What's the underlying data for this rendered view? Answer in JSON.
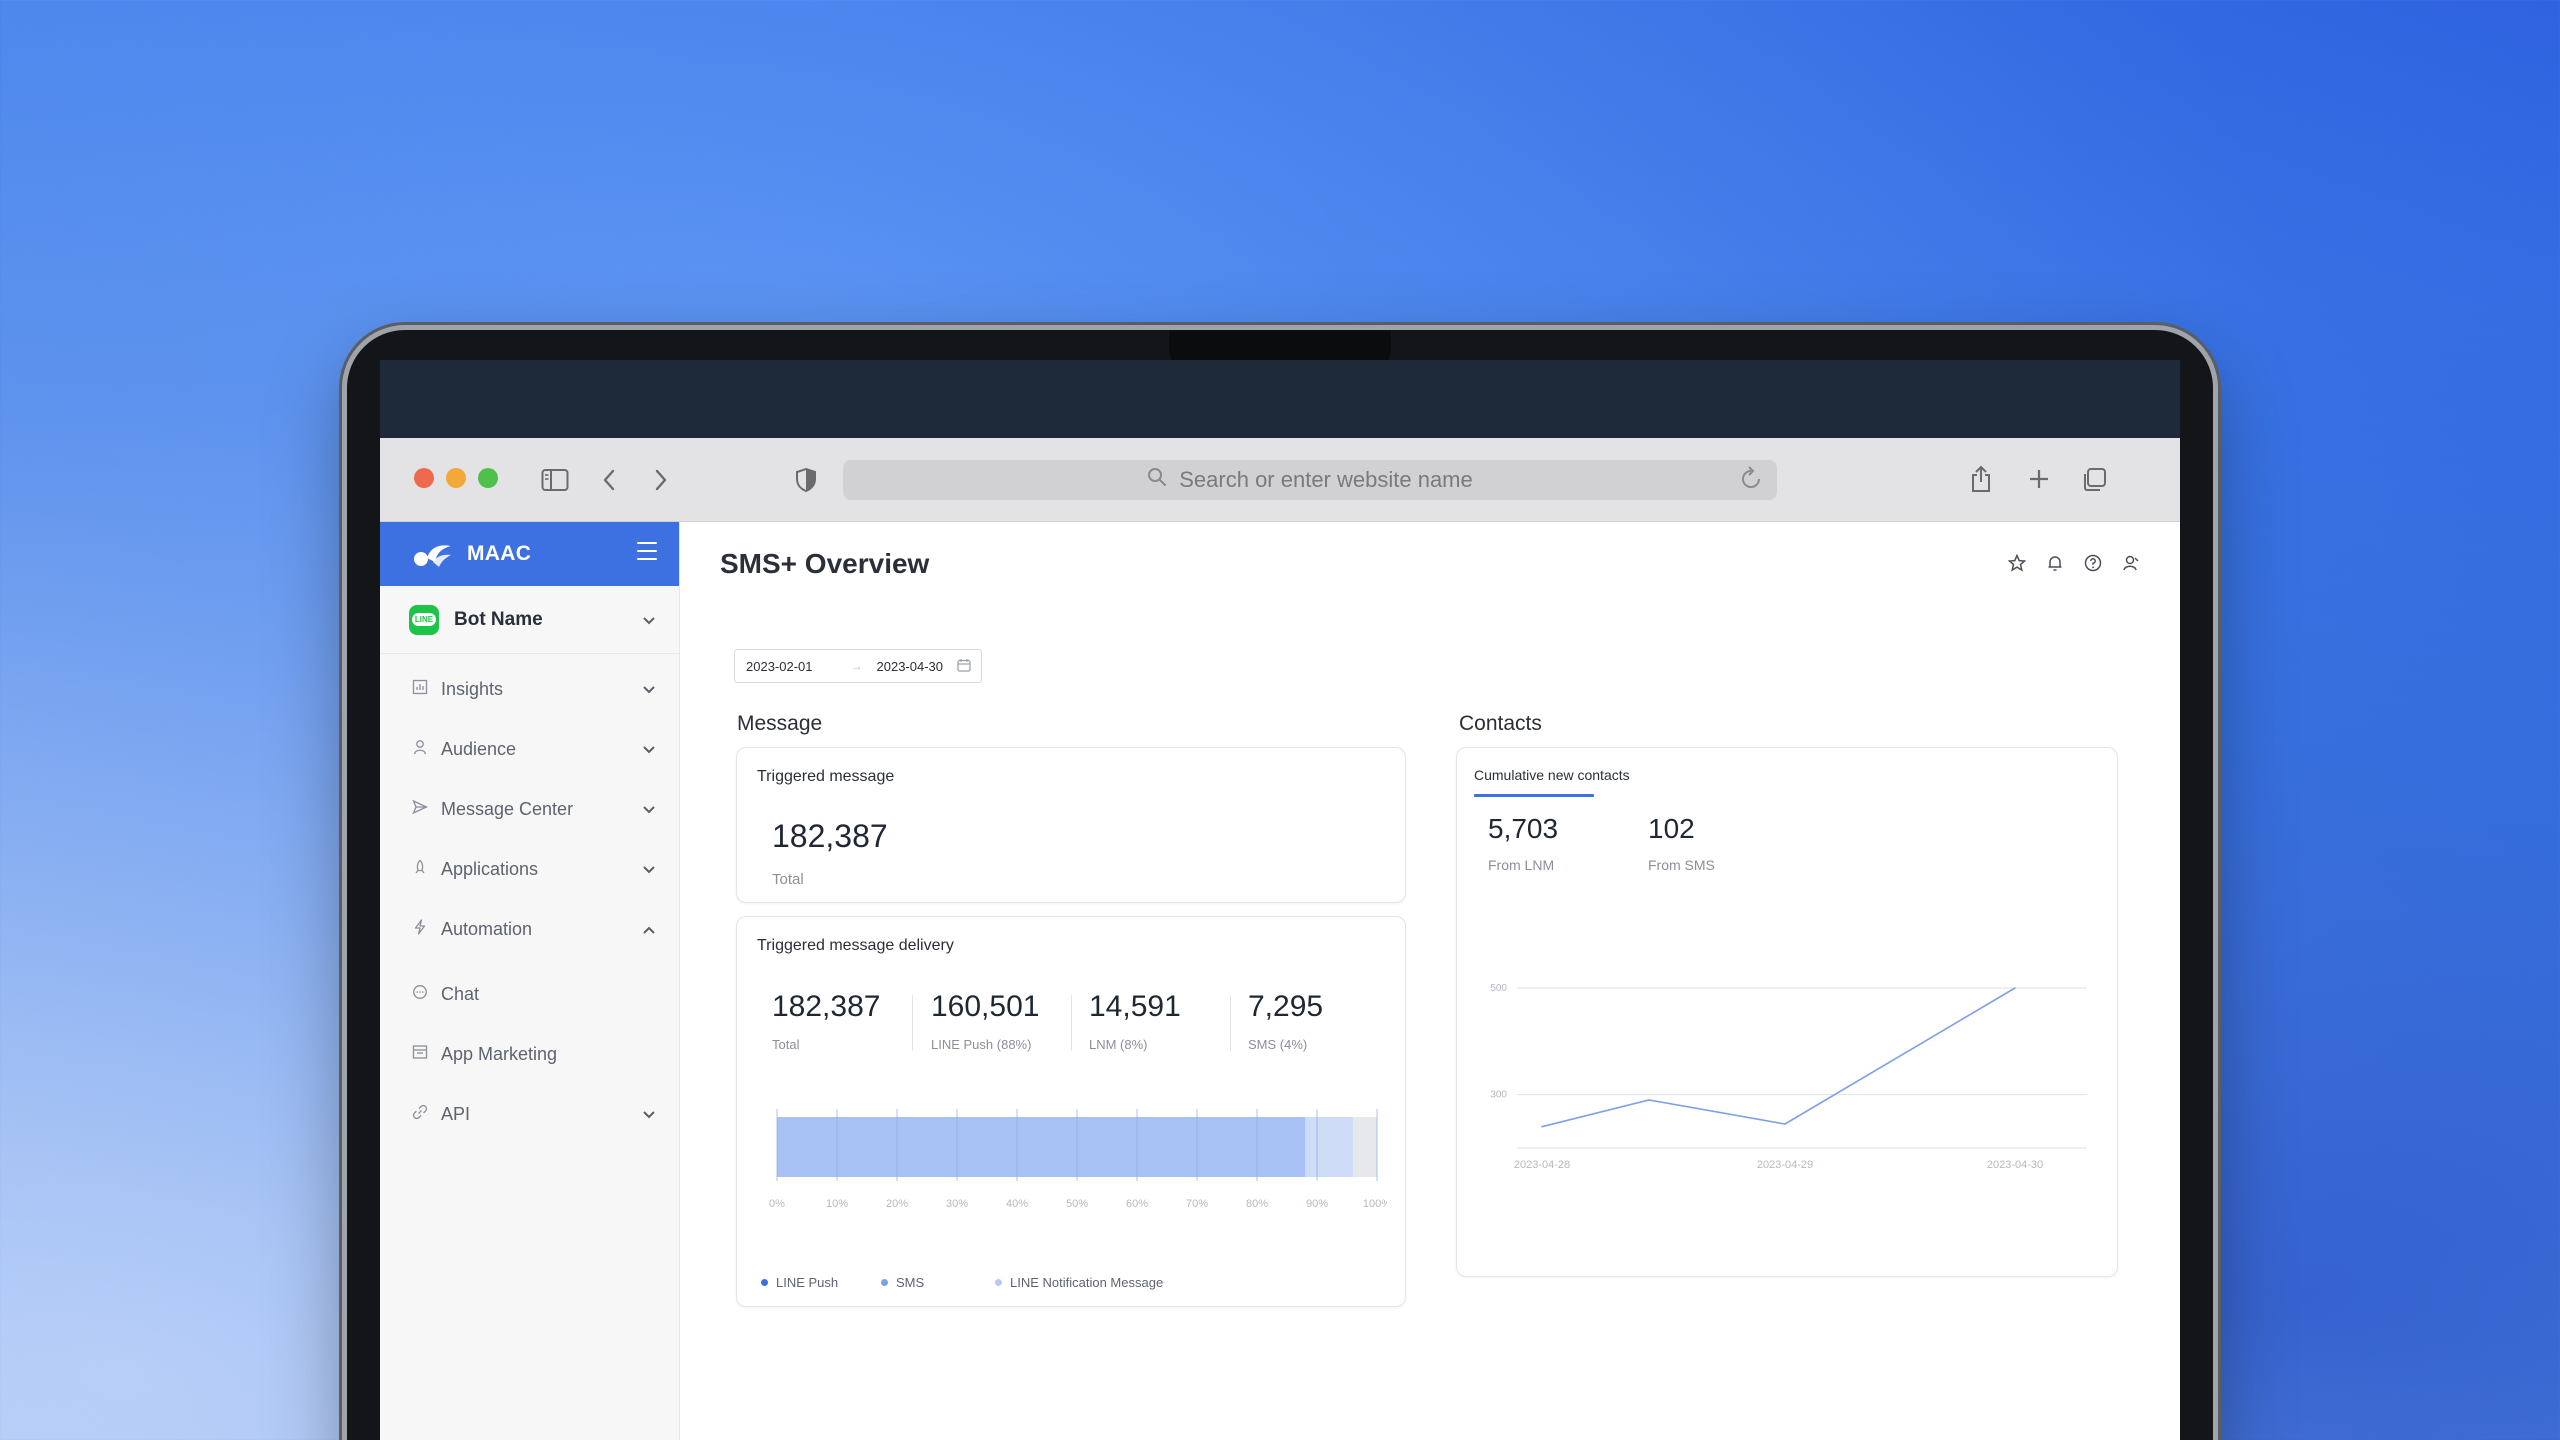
{
  "browser": {
    "url_placeholder": "Search or enter website name"
  },
  "colors": {
    "accent": "#3d70e0",
    "line_green": "#1fc34a",
    "bar_line_push": "#a9c2f5",
    "bar_sms": "#cfdcf8",
    "bar_lnm": "#e6e8ec",
    "chart_line": "#7ea0e8"
  },
  "sidebar": {
    "brand": "MAAC",
    "bot_name": "Bot Name",
    "items": [
      {
        "label": "Insights",
        "icon": "chart-icon",
        "chevron": "down"
      },
      {
        "label": "Audience",
        "icon": "person-icon",
        "chevron": "down"
      },
      {
        "label": "Message Center",
        "icon": "send-icon",
        "chevron": "down"
      },
      {
        "label": "Applications",
        "icon": "rocket-icon",
        "chevron": "down"
      },
      {
        "label": "Automation",
        "icon": "bolt-icon",
        "chevron": "up"
      },
      {
        "label": "Chat",
        "icon": "chat-icon",
        "chevron": ""
      },
      {
        "label": "App Marketing",
        "icon": "store-icon",
        "chevron": ""
      },
      {
        "label": "API",
        "icon": "link-icon",
        "chevron": "down"
      }
    ]
  },
  "header": {
    "title": "SMS+ Overview"
  },
  "date_range": {
    "start": "2023-02-01",
    "end": "2023-04-30"
  },
  "message": {
    "section_title": "Message",
    "triggered": {
      "title": "Triggered message",
      "value": "182,387",
      "label": "Total"
    },
    "delivery": {
      "title": "Triggered message delivery",
      "stats": [
        {
          "value": "182,387",
          "label": "Total"
        },
        {
          "value": "160,501",
          "label": "LINE Push (88%)"
        },
        {
          "value": "14,591",
          "label": "LNM (8%)"
        },
        {
          "value": "7,295",
          "label": "SMS (4%)"
        }
      ],
      "legend": [
        "LINE Push",
        "SMS",
        "LINE Notification Message"
      ]
    }
  },
  "contacts": {
    "section_title": "Contacts",
    "tab": "Cumulative new contacts",
    "stats": [
      {
        "value": "5,703",
        "label": "From LNM"
      },
      {
        "value": "102",
        "label": "From SMS"
      }
    ]
  },
  "chart_data": [
    {
      "type": "bar",
      "orientation": "horizontal-stacked",
      "series": [
        {
          "name": "LINE Push",
          "values": [
            88
          ]
        },
        {
          "name": "SMS",
          "values": [
            8
          ]
        },
        {
          "name": "LINE Notification Message",
          "values": [
            4
          ]
        }
      ],
      "xticks": [
        "0%",
        "10%",
        "20%",
        "30%",
        "40%",
        "50%",
        "60%",
        "70%",
        "80%",
        "90%",
        "100%"
      ],
      "xlim": [
        0,
        100
      ]
    },
    {
      "type": "line",
      "x": [
        "2023-04-28",
        "2023-04-29",
        "2023-04-30"
      ],
      "points": [
        {
          "x": "2023-04-28",
          "y": 240
        },
        {
          "x": "2023-04-28",
          "y": 290
        },
        {
          "x": "2023-04-29",
          "y": 245
        },
        {
          "x": "2023-04-30",
          "y": 500
        }
      ],
      "yticks": [
        "500",
        "300"
      ],
      "ylim": [
        200,
        500
      ],
      "grid": true
    }
  ]
}
